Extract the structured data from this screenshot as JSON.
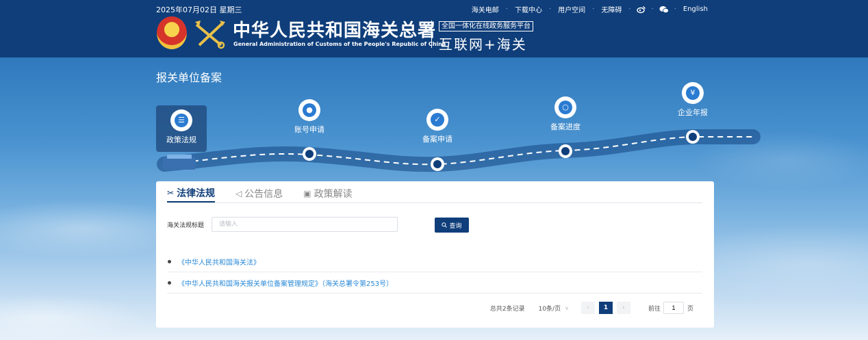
{
  "header": {
    "date": "2025年07月02日 星期三",
    "links": [
      "海关电邮",
      "下载中心",
      "用户空间",
      "无障碍"
    ],
    "social_icons": [
      "weibo-icon",
      "wechat-icon"
    ],
    "english": "English",
    "org_cn": "中华人民共和国海关总署",
    "org_en": "General Administration of Customs of the People's Republic of China",
    "platform_small": "全国一体化在线政务服务平台",
    "platform_big": "互联网+海关"
  },
  "page_title": "报关单位备案",
  "steps": [
    {
      "label": "政策法规",
      "icon": "list-icon"
    },
    {
      "label": "账号申请",
      "icon": "user-icon"
    },
    {
      "label": "备案申请",
      "icon": "shield-icon"
    },
    {
      "label": "备案进度",
      "icon": "search-icon"
    },
    {
      "label": "企业年报",
      "icon": "report-icon"
    }
  ],
  "tabs": [
    {
      "label": "法律法规",
      "icon": "tools-icon"
    },
    {
      "label": "公告信息",
      "icon": "speaker-icon"
    },
    {
      "label": "政策解读",
      "icon": "book-icon"
    }
  ],
  "search": {
    "label": "海关法规标题",
    "placeholder": "请输入",
    "button": "查询"
  },
  "list": [
    "《中华人民共和国海关法》",
    "《中华人民共和国海关报关单位备案管理规定》（海关总署令第253号）"
  ],
  "pager": {
    "total": "总共2条记录",
    "page_size": "10条/页",
    "current_page": "1",
    "goto_label": "前往",
    "goto_value": "1",
    "page_unit": "页"
  },
  "colors": {
    "header_bg": "#0f3e7a",
    "accent": "#0f3e7a",
    "link": "#2a8ad8"
  }
}
